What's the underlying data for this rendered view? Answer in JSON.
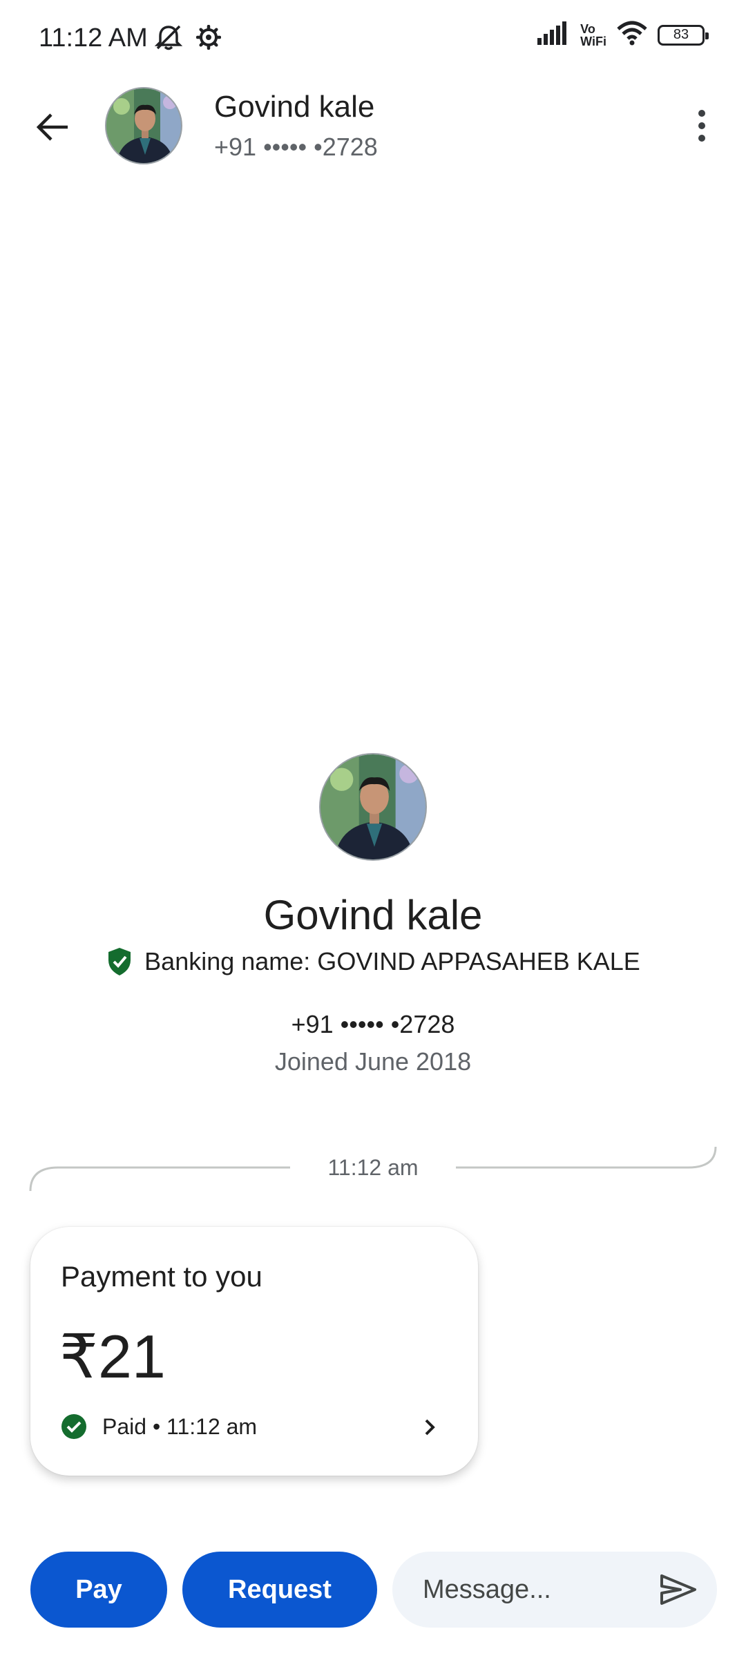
{
  "status_bar": {
    "time": "11:12 AM",
    "network_label_top": "Vo",
    "network_label_bottom": "WiFi",
    "battery_level": "83",
    "icons": [
      "muted-bell-icon",
      "settings-gear-icon",
      "signal-bars-icon",
      "wifi-icon",
      "battery-icon"
    ]
  },
  "header": {
    "contact_name": "Govind kale",
    "contact_phone": "+91 ••••• •2728",
    "back_icon": "arrow-back-icon",
    "more_icon": "more-vert-icon"
  },
  "profile": {
    "name": "Govind kale",
    "banking_name": "Banking name: GOVIND APPASAHEB KALE",
    "phone": "+91 ••••• •2728",
    "joined": "Joined June 2018",
    "verified_icon": "verified-shield-icon"
  },
  "conversation": {
    "divider_time": "11:12 am",
    "payment_card": {
      "title": "Payment to you",
      "amount": "₹21",
      "status": "Paid • 11:12 am",
      "status_icon": "check-circle-icon",
      "status_color": "#146c2e"
    }
  },
  "bottom_bar": {
    "pay_label": "Pay",
    "request_label": "Request",
    "message_placeholder": "Message...",
    "send_icon": "send-icon",
    "button_color": "#0b57d0"
  }
}
